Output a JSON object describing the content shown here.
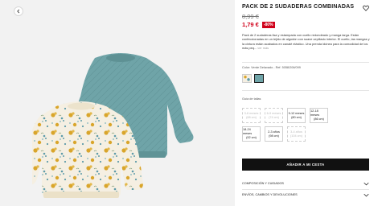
{
  "gallery": {
    "back_icon": "chevron-left-icon",
    "image_alt": "Pack de 2 sudaderas combinadas"
  },
  "product": {
    "title": "PACK DE 2 SUDADERAS COMBINADAS",
    "favorite_icon": "heart-icon",
    "old_price": "8,99 €",
    "new_price": "1,79 €",
    "discount": "-80%",
    "description": "Pack de 2 sudaderas lisa y estampada con cuello redondeado y manga larga. Están confeccionadas en un tejido de algodón con suave cepillado interior. El cuello, las mangas y la cintura están acabados en canalé elástico. Una prenda idónea para la comodidad de los más peq...",
    "ver_mas": "ver más"
  },
  "color": {
    "label": "Color: Verde Delavado - Ref. 5058/206/099",
    "swatch_icons": [
      "patterned-swatch",
      "teal-swatch"
    ]
  },
  "sizes": {
    "label": "Guía de tallas",
    "items": [
      {
        "name": "3-6 meses",
        "detail": "(68 cm)",
        "available": false
      },
      {
        "name": "6-9 meses",
        "detail": "(74 cm)",
        "available": false
      },
      {
        "name": "9-12 meses",
        "detail": "(80 cm)",
        "available": true
      },
      {
        "name": "12-18 meses",
        "detail": "(86 cm)",
        "available": true
      },
      {
        "name": "18-24 meses",
        "detail": "(92 cm)",
        "available": true
      },
      {
        "name": "2-3 años",
        "detail": "(98 cm)",
        "available": true
      },
      {
        "name": "3-4 años",
        "detail": "(104 cm)",
        "available": false
      }
    ]
  },
  "actions": {
    "add_to_cart": "AÑADIR A MI CESTA"
  },
  "accordions": {
    "composition": "COMPOSICIÓN Y CUIDADOS",
    "shipping": "ENVÍOS, CAMBIOS Y DEVOLUCIONES"
  },
  "colors": {
    "accent_red": "#d0021b",
    "button_black": "#111111",
    "teal_sweatshirt": "#6fa4a8",
    "cream_sweatshirt": "#f5efe2",
    "mustard_pattern": "#d9a52b"
  }
}
